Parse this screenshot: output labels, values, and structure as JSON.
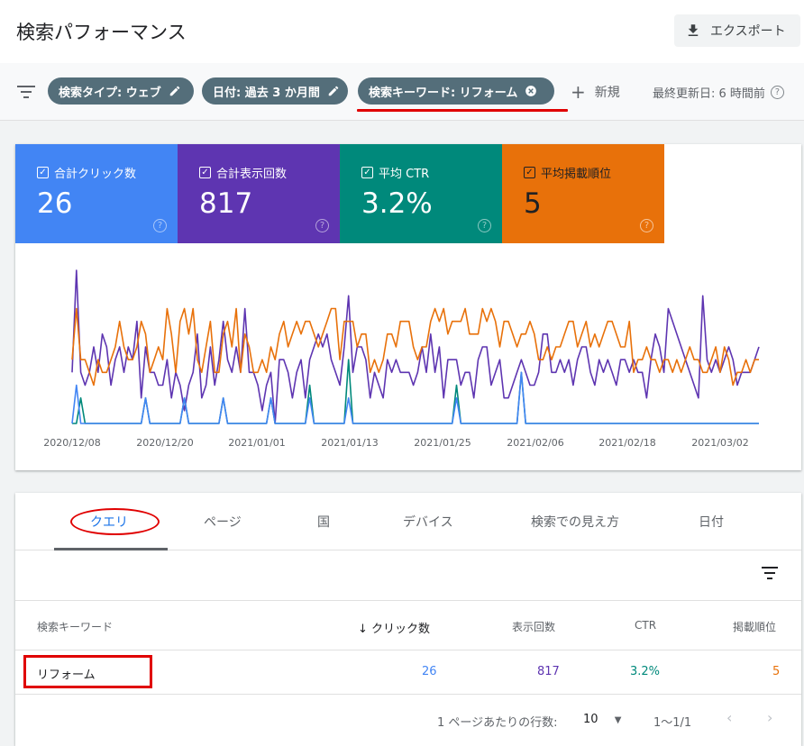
{
  "header": {
    "title": "検索パフォーマンス",
    "export_label": "エクスポート"
  },
  "filters": {
    "chips": [
      "検索タイプ: ウェブ",
      "日付: 過去 3 か月間",
      "検索キーワード: リフォーム"
    ],
    "new_label": "新規",
    "updated_label": "最終更新日: 6 時間前"
  },
  "metrics": [
    {
      "label": "合計クリック数",
      "value": "26",
      "color": "#4285f4"
    },
    {
      "label": "合計表示回数",
      "value": "817",
      "color": "#5e35b1"
    },
    {
      "label": "平均 CTR",
      "value": "3.2%",
      "color": "#00897b"
    },
    {
      "label": "平均掲載順位",
      "value": "5",
      "color": "#e8710a"
    }
  ],
  "chart_data": {
    "type": "line",
    "x_tick_labels": [
      "2020/12/08",
      "2020/12/20",
      "2021/01/01",
      "2021/01/13",
      "2021/01/25",
      "2021/02/06",
      "2021/02/18",
      "2021/03/02"
    ],
    "series": [
      {
        "name": "合計表示回数",
        "color": "#5e35b1",
        "values": [
          4,
          12,
          4,
          3,
          4,
          6,
          4,
          7,
          6,
          3,
          5,
          6,
          4,
          6,
          5,
          8,
          2,
          6,
          4,
          4,
          3,
          3,
          5,
          2,
          4,
          3,
          1,
          3,
          4,
          7,
          2,
          3,
          6,
          3,
          5,
          8,
          5,
          4,
          6,
          4,
          9,
          4,
          4,
          3,
          1,
          3,
          4,
          0,
          5,
          5,
          4,
          2,
          4,
          5,
          2,
          5,
          6,
          7,
          6,
          7,
          5,
          4,
          3,
          6,
          10,
          4,
          6,
          6,
          5,
          2,
          4,
          3,
          2,
          5,
          4,
          5,
          4,
          4,
          4,
          3,
          4,
          6,
          4,
          7,
          4,
          6,
          2,
          5,
          5,
          5,
          3,
          4,
          4,
          2,
          5,
          6,
          6,
          3,
          4,
          5,
          2,
          2,
          3,
          4,
          5,
          4,
          3,
          3,
          4,
          7,
          7,
          4,
          4,
          5,
          4,
          5,
          3,
          5,
          6,
          6,
          4,
          3,
          5,
          4,
          5,
          4,
          3,
          5,
          5,
          4,
          5,
          4,
          4,
          2,
          5,
          7,
          6,
          4,
          9,
          8,
          7,
          6,
          5,
          4,
          3,
          2,
          10,
          5,
          4,
          5,
          4,
          5,
          6,
          5,
          3,
          4,
          4,
          4,
          5,
          6
        ]
      },
      {
        "name": "平均掲載順位",
        "color": "#e8710a",
        "values": [
          5,
          9,
          5,
          5,
          4,
          3,
          5,
          4,
          4,
          5,
          6,
          8,
          6,
          5,
          5,
          6,
          8,
          7,
          4,
          5,
          6,
          5,
          9,
          7,
          4,
          8,
          9,
          7,
          9,
          5,
          4,
          6,
          8,
          4,
          4,
          7,
          8,
          6,
          9,
          4,
          7,
          6,
          4,
          4,
          5,
          4,
          6,
          5,
          7,
          8,
          6,
          7,
          8,
          7,
          8,
          8,
          7,
          6,
          7,
          8,
          9,
          9,
          5,
          8,
          8,
          8,
          6,
          7,
          7,
          4,
          5,
          4,
          5,
          7,
          7,
          6,
          8,
          8,
          8,
          6,
          5,
          6,
          6,
          8,
          9,
          8,
          9,
          7,
          8,
          8,
          8,
          9,
          7,
          7,
          7,
          9,
          8,
          9,
          8,
          6,
          8,
          8,
          7,
          6,
          7,
          7,
          8,
          7,
          5,
          5,
          6,
          5,
          6,
          6,
          7,
          8,
          8,
          6,
          7,
          8,
          6,
          7,
          6,
          7,
          8,
          8,
          7,
          6,
          6,
          8,
          4,
          5,
          5,
          6,
          5,
          5,
          4,
          5,
          5,
          4,
          5,
          4,
          5,
          6,
          5,
          5,
          4,
          4,
          5,
          6,
          4,
          6,
          5,
          3,
          4,
          4,
          5,
          4,
          5,
          5
        ]
      },
      {
        "name": "平均 CTR",
        "color": "#00897b",
        "values": [
          0,
          0,
          2,
          0,
          0,
          0,
          0,
          0,
          0,
          0,
          0,
          0,
          0,
          0,
          0,
          0,
          0,
          2,
          0,
          0,
          0,
          0,
          0,
          0,
          0,
          0,
          2,
          0,
          0,
          0,
          0,
          0,
          0,
          0,
          0,
          2,
          0,
          0,
          0,
          0,
          0,
          0,
          0,
          0,
          0,
          0,
          2,
          0,
          0,
          0,
          0,
          0,
          0,
          0,
          0,
          3,
          0,
          0,
          0,
          0,
          0,
          0,
          0,
          0,
          5,
          0,
          0,
          0,
          0,
          0,
          0,
          0,
          0,
          0,
          0,
          0,
          0,
          0,
          0,
          0,
          0,
          0,
          0,
          0,
          0,
          0,
          0,
          0,
          0,
          3,
          0,
          0,
          0,
          0,
          0,
          0,
          0,
          0,
          0,
          0,
          0,
          0,
          0,
          0,
          4,
          0,
          0,
          0,
          0,
          0,
          0,
          0,
          0,
          0,
          0,
          0,
          0,
          0,
          0,
          0,
          0,
          0,
          0,
          0,
          0,
          0,
          0,
          0,
          0,
          0,
          0,
          0,
          0,
          0,
          0,
          0,
          0,
          0,
          0,
          0,
          0,
          0,
          0,
          0,
          0,
          0,
          0,
          0,
          0,
          0,
          0,
          0,
          0,
          0,
          0,
          0,
          0,
          0,
          0,
          0
        ]
      },
      {
        "name": "合計クリック数",
        "color": "#4285f4",
        "values": [
          0,
          3,
          0,
          0,
          0,
          0,
          0,
          0,
          0,
          0,
          0,
          0,
          0,
          0,
          0,
          0,
          0,
          2,
          0,
          0,
          0,
          0,
          0,
          0,
          0,
          0,
          2,
          0,
          0,
          0,
          0,
          0,
          0,
          0,
          0,
          2,
          0,
          0,
          0,
          0,
          0,
          0,
          0,
          0,
          0,
          0,
          2,
          0,
          0,
          0,
          0,
          0,
          0,
          0,
          0,
          2,
          0,
          0,
          0,
          0,
          0,
          0,
          0,
          0,
          2,
          0,
          0,
          0,
          0,
          0,
          0,
          0,
          0,
          0,
          0,
          0,
          0,
          0,
          0,
          0,
          0,
          0,
          0,
          0,
          0,
          0,
          0,
          0,
          0,
          2,
          0,
          0,
          0,
          0,
          0,
          0,
          0,
          0,
          0,
          0,
          0,
          0,
          0,
          0,
          4,
          0,
          0,
          0,
          0,
          0,
          0,
          0,
          0,
          0,
          0,
          0,
          0,
          0,
          0,
          0,
          0,
          0,
          0,
          0,
          0,
          0,
          0,
          0,
          0,
          0,
          0,
          0,
          0,
          0,
          0,
          0,
          0,
          0,
          0,
          0,
          0,
          0,
          0,
          0,
          0,
          0,
          0,
          0,
          0,
          0,
          0,
          0,
          0,
          0,
          0,
          0,
          0,
          0,
          0,
          0
        ]
      }
    ],
    "grid": false,
    "legend": "none"
  },
  "tabs": [
    "クエリ",
    "ページ",
    "国",
    "デバイス",
    "検索での見え方",
    "日付"
  ],
  "table": {
    "columns": [
      "検索キーワード",
      "クリック数",
      "表示回数",
      "CTR",
      "掲載順位"
    ],
    "rows": [
      {
        "keyword": "リフォーム",
        "clicks": "26",
        "impressions": "817",
        "ctr": "3.2%",
        "position": "5"
      }
    ],
    "colors": {
      "clicks": "#4285f4",
      "impressions": "#5e35b1",
      "ctr": "#00897b",
      "position": "#e8710a"
    }
  },
  "pagination": {
    "rows_label": "1 ページあたりの行数:",
    "rows_value": "10",
    "range": "1〜1/1"
  }
}
